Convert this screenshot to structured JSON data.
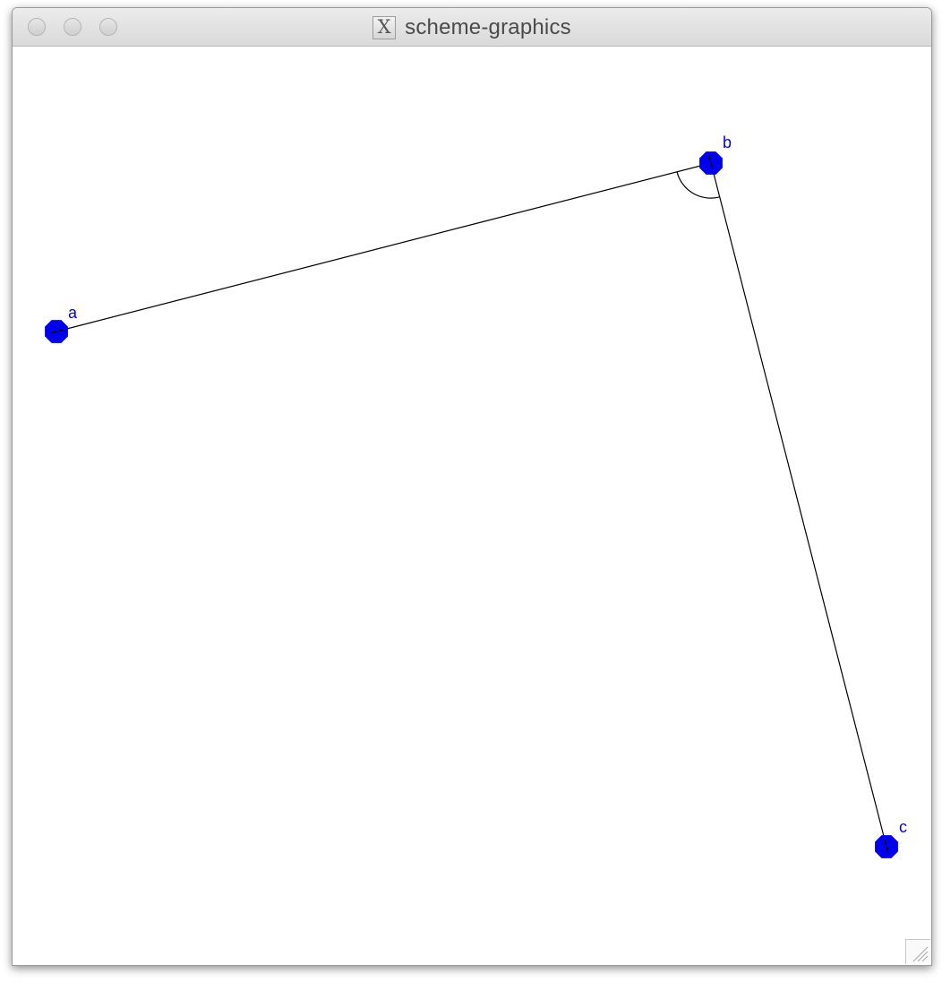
{
  "window": {
    "title": "scheme-graphics",
    "app_icon": "x11-icon",
    "app_icon_glyph": "X"
  },
  "title_buttons": [
    "close",
    "minimize",
    "zoom"
  ],
  "drawing": {
    "point_color": "#0000ee",
    "label_color": "#0000ee",
    "line_color": "#000000",
    "points": [
      {
        "id": "a",
        "label": "a"
      },
      {
        "id": "b",
        "label": "b"
      },
      {
        "id": "c",
        "label": "c"
      }
    ],
    "segments": [
      {
        "from": "a",
        "to": "b"
      },
      {
        "from": "b",
        "to": "c"
      }
    ],
    "angle_marker": {
      "vertex": "b",
      "between": [
        "a",
        "c"
      ]
    }
  }
}
